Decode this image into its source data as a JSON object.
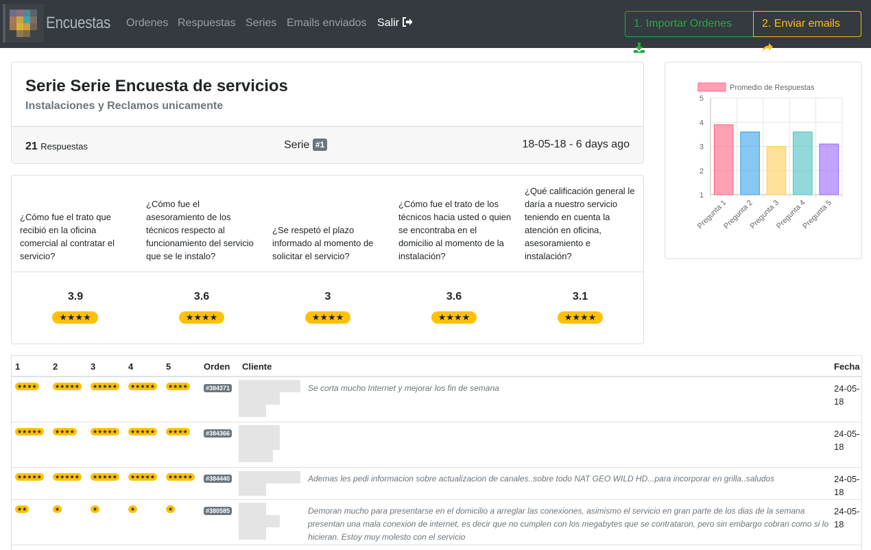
{
  "navbar": {
    "brand": "Encuestas",
    "links": [
      "Ordenes",
      "Respuestas",
      "Series",
      "Emails enviados"
    ],
    "logout_label": "Salir",
    "import_button": "1. Importar Ordenes",
    "email_button": "2. Enviar emails"
  },
  "serie": {
    "title": "Serie Serie Encuesta de servicios",
    "subtitle": "Instalaciones y Reclamos unicamente",
    "responses_count": "21",
    "responses_label": "Respuestas",
    "serie_label": "Serie",
    "serie_badge": "#1",
    "date": "18-05-18 - 6 days ago"
  },
  "questions": [
    {
      "text": "¿Cómo fue el trato que recibió en la oficina comercial al contratar el servicio?",
      "score": "3.9",
      "stars": "★★★★"
    },
    {
      "text": "¿Cómo fue el asesoramiento de los técnicos respecto al funcionamiento del servicio que se le instalo?",
      "score": "3.6",
      "stars": "★★★★"
    },
    {
      "text": "¿Se respetó el plazo informado al momento de solicitar el servicio?",
      "score": "3",
      "stars": "★★★★"
    },
    {
      "text": "¿Cómo fue el trato de los técnicos hacia usted o quien se encontraba en el domicilio al momento de la instalación?",
      "score": "3.6",
      "stars": "★★★★"
    },
    {
      "text": "¿Qué calificación general le daría a nuestro servicio teniendo en cuenta la atención en oficina, asesoramiento e instalación?",
      "score": "3.1",
      "stars": "★★★★"
    }
  ],
  "chart_data": {
    "type": "bar",
    "categories": [
      "Pregunta 1",
      "Pregunta 2",
      "Pregunta 3",
      "Pregunta 4",
      "Pregunta 5"
    ],
    "series": [
      {
        "name": "Promedio de Respuestas",
        "values": [
          3.9,
          3.6,
          3.0,
          3.6,
          3.1
        ]
      }
    ],
    "ylim": [
      1,
      5
    ],
    "yticks": [
      "5",
      "4",
      "3",
      "2",
      "1"
    ],
    "colors": [
      "#ff6384",
      "#36a2eb",
      "#ffcd56",
      "#4bc0c0",
      "#9966ff"
    ],
    "legend": "top"
  },
  "table": {
    "headers": {
      "q1": "1",
      "q2": "2",
      "q3": "3",
      "q4": "4",
      "q5": "5",
      "order": "Orden",
      "client": "Cliente",
      "date": "Fecha"
    },
    "rows": [
      {
        "stars": [
          "★★★★",
          "★★★★★",
          "★★★★★",
          "★★★★★",
          "★★★★"
        ],
        "order": "#384371",
        "comment": "Se corta mucho Internet y mejorar los fin de semana",
        "date": "24-05-18"
      },
      {
        "stars": [
          "★★★★★",
          "★★★★",
          "★★★★★",
          "★★★★★",
          "★★★★"
        ],
        "order": "#384366",
        "comment": "",
        "date": "24-05-18"
      },
      {
        "stars": [
          "★★★★★",
          "★★★★★",
          "★★★★★",
          "★★★★★",
          "★★★★★"
        ],
        "order": "#384440",
        "comment": "Ademas les pedi informacion sobre actualizacion de canales..sobre todo NAT GEO WILD HD...para incorporar en grilla..saludos",
        "date": "24-05-18"
      },
      {
        "stars": [
          "★★",
          "★",
          "★",
          "★",
          "★"
        ],
        "order": "#380585",
        "comment": "Demoran mucho para presentarse en el domicilio a arreglar las conexiones, asimismo el servicio en gran parte de los dias de la semana presentan una mala conexion de internet, es decir que no cumplen con los megabytes que se contrataron, pero sin embargo cobran como si lo hicieran. Estoy muy molesto con el servicio",
        "date": "24-05-18"
      }
    ]
  }
}
